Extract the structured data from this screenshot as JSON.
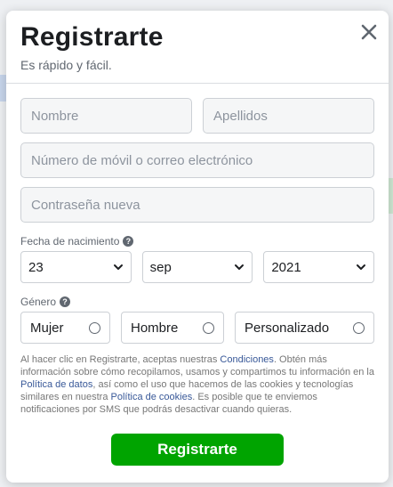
{
  "header": {
    "title": "Registrarte",
    "subtitle": "Es rápido y fácil."
  },
  "form": {
    "first_name_placeholder": "Nombre",
    "last_name_placeholder": "Apellidos",
    "contact_placeholder": "Número de móvil o correo electrónico",
    "password_placeholder": "Contraseña nueva",
    "birthday_label": "Fecha de nacimiento",
    "birthday": {
      "day": "23",
      "month": "sep",
      "year": "2021"
    },
    "gender_label": "Género",
    "genders": [
      "Mujer",
      "Hombre",
      "Personalizado"
    ],
    "help_glyph": "?"
  },
  "terms": {
    "t1": "Al hacer clic en Registrarte, aceptas nuestras ",
    "link_conditions": "Condiciones",
    "t2": ". Obtén más información sobre cómo recopilamos, usamos y compartimos tu información en la ",
    "link_data_policy": "Política de datos",
    "t3": ", así como el uso que hacemos de las cookies y tecnologías similares en nuestra ",
    "link_cookie_policy": "Política de cookies",
    "t4": ". Es posible que te enviemos notificaciones por SMS que podrás desactivar cuando quieras."
  },
  "submit_label": "Registrarte",
  "colors": {
    "submit": "#00a400",
    "link": "#385898",
    "title": "#1c1e21"
  }
}
